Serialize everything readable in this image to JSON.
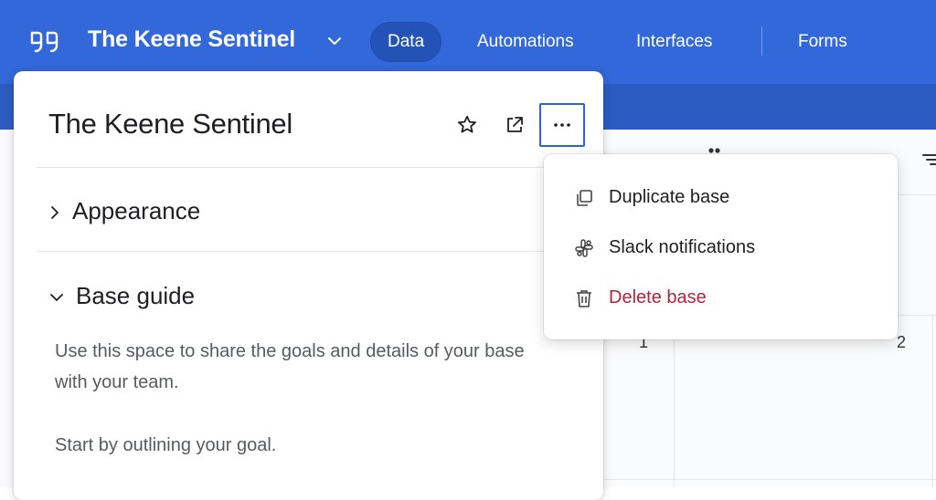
{
  "app": {
    "base_title": "The Keene Sentinel",
    "nav": [
      {
        "label": "Data",
        "active": true
      },
      {
        "label": "Automations",
        "active": false
      },
      {
        "label": "Interfaces",
        "active": false
      },
      {
        "label": "Forms",
        "active": false
      }
    ]
  },
  "panel": {
    "title": "The Keene Sentinel",
    "sections": [
      {
        "label": "Appearance",
        "expanded": false
      },
      {
        "label": "Base guide",
        "expanded": true
      }
    ],
    "guide_paragraphs": [
      "Use this space to share the goals and details of your base with your team.",
      "Start by outlining your goal."
    ]
  },
  "menu": {
    "items": [
      {
        "label": "Duplicate base",
        "icon": "duplicate-icon"
      },
      {
        "label": "Slack notifications",
        "icon": "slack-icon"
      },
      {
        "label": "Delete base",
        "icon": "trash-icon",
        "danger": true
      }
    ]
  },
  "grid": {
    "row_numbers": [
      "1",
      "2"
    ]
  },
  "colors": {
    "topbar": "#3268d9",
    "active_nav": "#2453b8",
    "danger": "#b0243d",
    "focus_border": "#2f62d4"
  }
}
